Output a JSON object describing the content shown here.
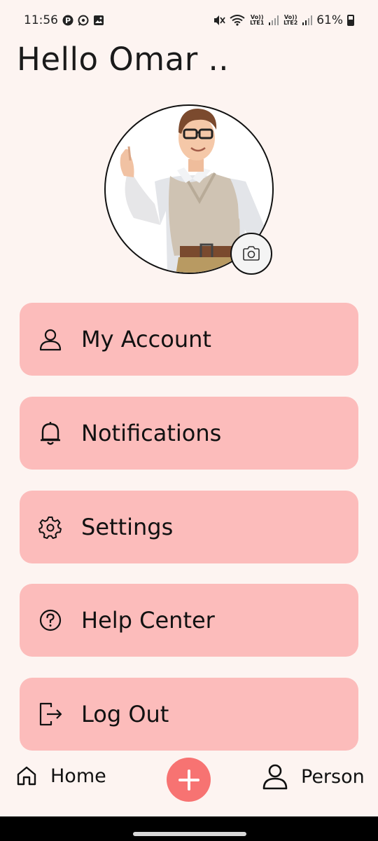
{
  "status_bar": {
    "time": "11:56",
    "notification_icons": [
      "pinterest-icon",
      "whatsapp-icon",
      "gallery-icon"
    ],
    "sim1_label": "Vo)) LTE1",
    "sim2_label": "Vo)) LTE2",
    "battery": "61%"
  },
  "greeting": "Hello Omar ..",
  "profile": {
    "avatar_icon": "avatar-3d-man-waving",
    "camera_icon": "camera-icon"
  },
  "menu": [
    {
      "label": "My Account",
      "icon": "person-icon"
    },
    {
      "label": "Notifications",
      "icon": "bell-icon"
    },
    {
      "label": "Settings",
      "icon": "gear-icon"
    },
    {
      "label": "Help Center",
      "icon": "help-icon"
    },
    {
      "label": "Log Out",
      "icon": "logout-icon"
    }
  ],
  "bottom_nav": {
    "home_label": "Home",
    "person_label": "Person",
    "add_icon": "plus-icon"
  },
  "colors": {
    "background": "#fdf4f1",
    "menu_item": "#fcbcbb",
    "accent": "#f77372"
  }
}
